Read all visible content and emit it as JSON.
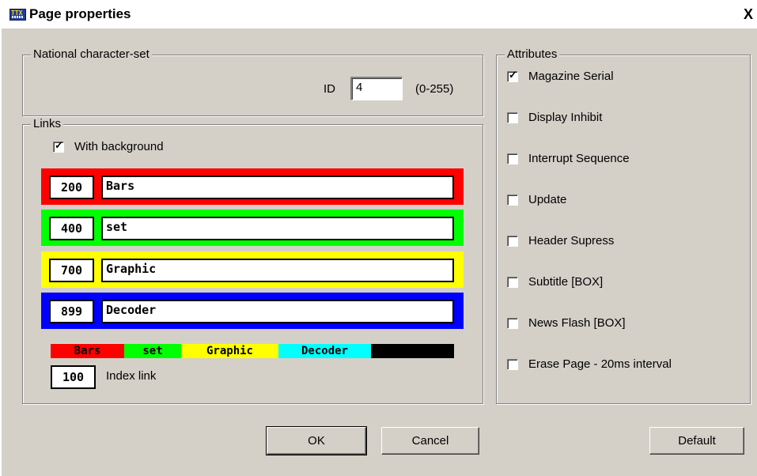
{
  "window": {
    "title": "Page properties",
    "app_icon": "ttx-icon",
    "app_icon_text": "TTX",
    "close_label": "X"
  },
  "national": {
    "legend": "National character-set",
    "id_label": "ID",
    "id_value": "4",
    "range": "(0-255)"
  },
  "links": {
    "legend": "Links",
    "with_background_label": "With background",
    "with_background_checked": true,
    "rows": [
      {
        "page": "200",
        "text": "Bars",
        "color": "#ff0000"
      },
      {
        "page": "400",
        "text": "set",
        "color": "#00ff00"
      },
      {
        "page": "700",
        "text": "Graphic",
        "color": "#ffff00"
      },
      {
        "page": "899",
        "text": "Decoder",
        "color": "#0000ff"
      }
    ],
    "preview": [
      {
        "text": "Bars",
        "bg": "#ff0000",
        "fg": "#000000"
      },
      {
        "text": "set",
        "bg": "#00ff00",
        "fg": "#000000"
      },
      {
        "text": "Graphic",
        "bg": "#ffff00",
        "fg": "#000000"
      },
      {
        "text": "Decoder",
        "bg": "#00ffff",
        "fg": "#000000"
      },
      {
        "text": "",
        "bg": "#000000",
        "fg": "#000000"
      }
    ],
    "index_page": "100",
    "index_label": "Index link"
  },
  "attributes": {
    "legend": "Attributes",
    "items": [
      {
        "label": "Magazine Serial",
        "checked": true
      },
      {
        "label": "Display Inhibit",
        "checked": false
      },
      {
        "label": "Interrupt Sequence",
        "checked": false
      },
      {
        "label": "Update",
        "checked": false
      },
      {
        "label": "Header Supress",
        "checked": false
      },
      {
        "label": "Subtitle [BOX]",
        "checked": false
      },
      {
        "label": "News Flash [BOX]",
        "checked": false
      },
      {
        "label": "Erase Page - 20ms interval",
        "checked": false
      }
    ]
  },
  "buttons": {
    "ok": "OK",
    "cancel": "Cancel",
    "default": "Default"
  }
}
